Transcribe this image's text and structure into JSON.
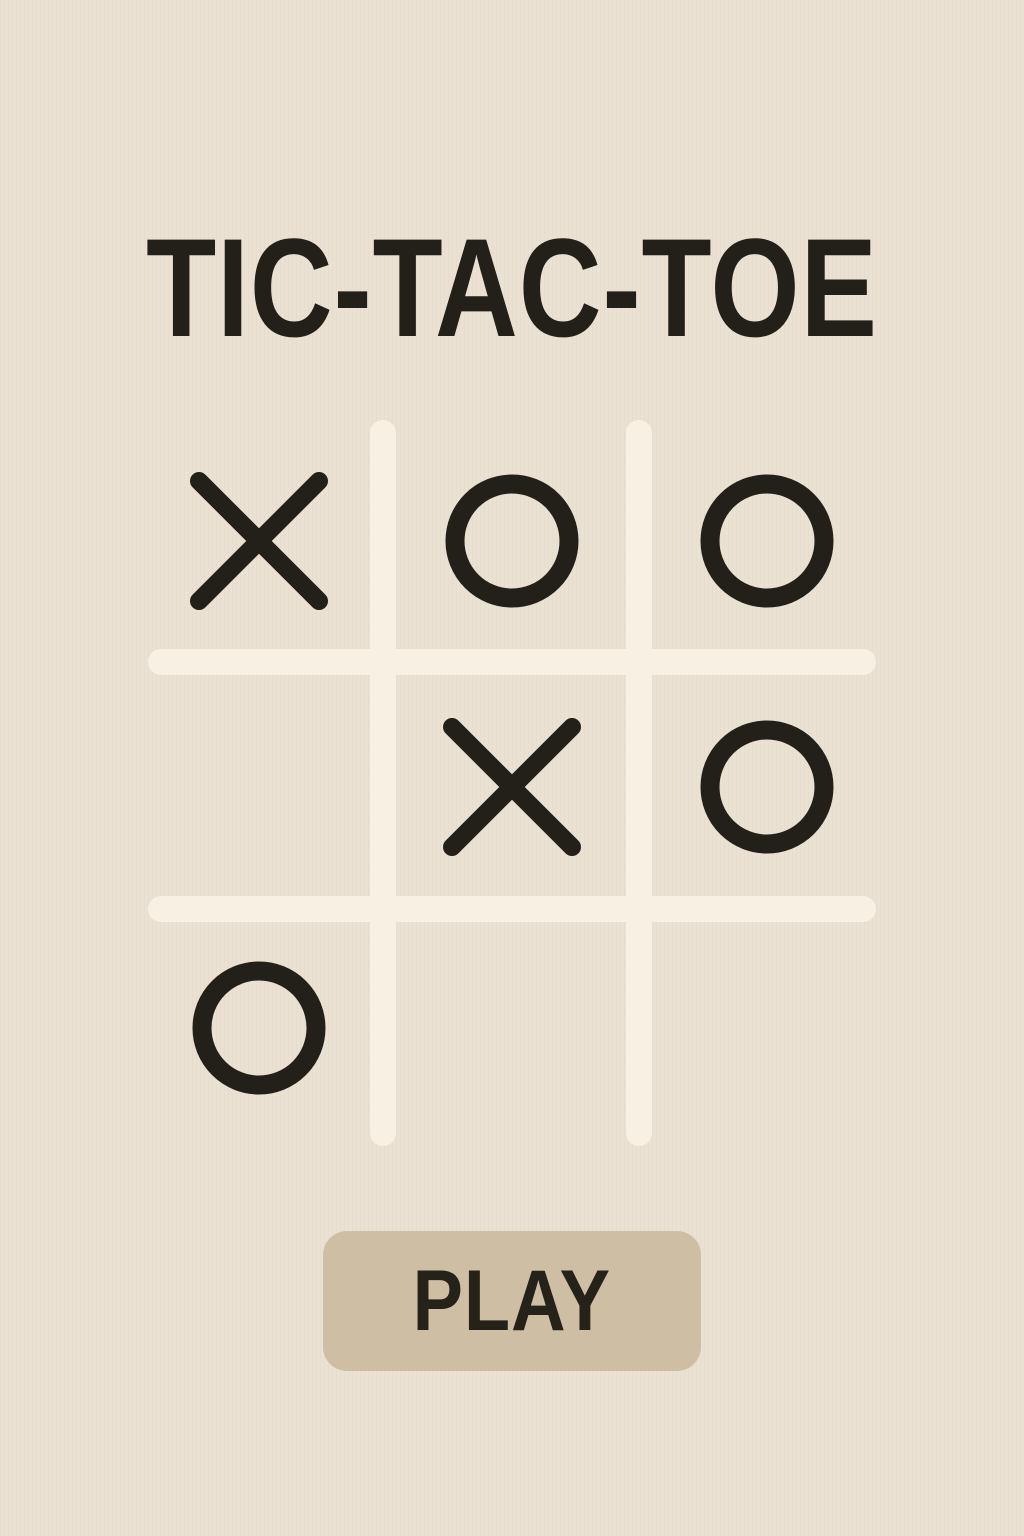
{
  "title": "TIC-TAC-TOE",
  "board": {
    "cells": [
      "X",
      "O",
      "O",
      "",
      "X",
      "O",
      "O",
      "",
      ""
    ]
  },
  "play_button": {
    "label": "PLAY"
  },
  "colors": {
    "background": "#ebe1d2",
    "grid": "#f8f0e2",
    "mark": "#222019",
    "button": "#cebea3",
    "text": "#222019"
  },
  "icons": {
    "x_mark": "x-mark-icon",
    "o_mark": "o-mark-icon"
  }
}
